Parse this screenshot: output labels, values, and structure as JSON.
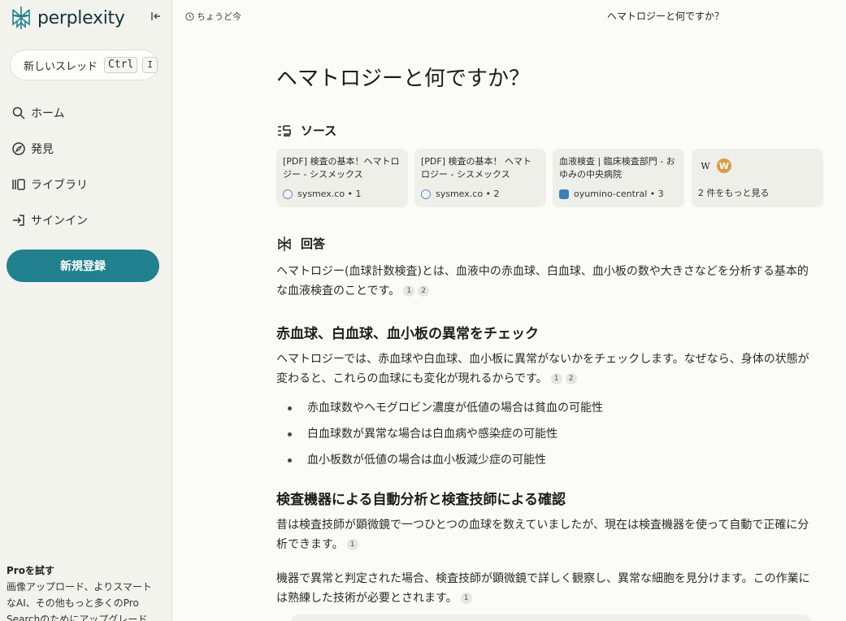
{
  "sidebar": {
    "logo_text": "perplexity",
    "new_thread": {
      "label": "新しいスレッド",
      "kbd1": "Ctrl",
      "kbd2": "I"
    },
    "nav": [
      {
        "label": "ホーム",
        "icon": "search-icon"
      },
      {
        "label": "発見",
        "icon": "compass-icon"
      },
      {
        "label": "ライブラリ",
        "icon": "library-icon"
      },
      {
        "label": "サインイン",
        "icon": "sign-in-icon"
      }
    ],
    "signup_label": "新規登録",
    "pro": {
      "title": "Proを試す",
      "desc": "画像アップロード、よりスマートなAI、その他もっと多くのPro Searchのためにアップグレード"
    }
  },
  "topbar": {
    "time": "ちょうど今",
    "title": "ヘマトロジーと何ですか？"
  },
  "main": {
    "question": "ヘマトロジーと何ですか？",
    "sources_heading": "ソース",
    "sources": [
      {
        "title": "[PDF] 検査の基本！ヘマトロジー - シスメックス",
        "domain": "sysmex.co",
        "index": "1"
      },
      {
        "title": "[PDF] 検査の基本！ ヘマトロジー - シスメックス",
        "domain": "sysmex.co",
        "index": "2"
      },
      {
        "title": "血液検査 | 臨床検査部門 - おゆみの中央病院",
        "domain": "oyumino-central",
        "index": "3"
      }
    ],
    "more_sources": {
      "w1": "W",
      "w2": "W",
      "label": "2 件をもっと見る"
    },
    "answer_heading": "回答",
    "intro": "ヘマトロジー(血球計数検査)とは、血液中の赤血球、白血球、血小板の数や大きさなどを分析する基本的な血液検査のことです。",
    "intro_cites": [
      "1",
      "2"
    ],
    "section1": {
      "heading": "赤血球、白血球、血小板の異常をチェック",
      "text": "ヘマトロジーでは、赤血球や白血球、血小板に異常がないかをチェックします。なぜなら、身体の状態が変わると、これらの血球にも変化が現れるからです。",
      "cites": [
        "1",
        "2"
      ],
      "bullets": [
        "赤血球数やヘモグロビン濃度が低値の場合は貧血の可能性",
        "白血球数が異常な場合は白血病や感染症の可能性",
        "血小板数が低値の場合は血小板減少症の可能性"
      ]
    },
    "section2": {
      "heading": "検査機器による自動分析と検査技師による確認",
      "text1": "昔は検査技師が顕微鏡で一つひとつの血球を数えていましたが、現在は検査機器を使って自動で正確に分析できます。",
      "cites1": [
        "1"
      ],
      "text2": "機器で異常と判定された場合、検査技師が顕微鏡で詳しく観察し、異常な細胞を見分けます。この作業には熟練した技術が必要とされます。",
      "cites2": [
        "1"
      ]
    }
  },
  "colors": {
    "accent": "#20808d",
    "background": "#fbfbf7",
    "sidebar": "#f3f3ee"
  }
}
